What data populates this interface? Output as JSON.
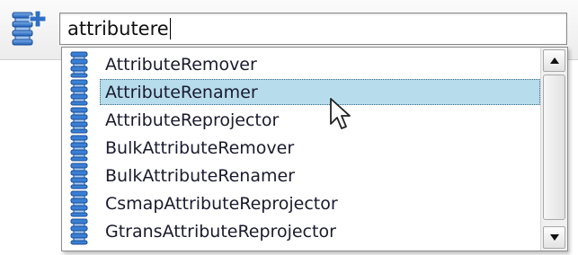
{
  "search": {
    "value": "attributere"
  },
  "suggestions": [
    {
      "label": "AttributeRemover",
      "selected": false
    },
    {
      "label": "AttributeRenamer",
      "selected": true
    },
    {
      "label": "AttributeReprojector",
      "selected": false
    },
    {
      "label": "BulkAttributeRemover",
      "selected": false
    },
    {
      "label": "BulkAttributeRenamer",
      "selected": false
    },
    {
      "label": "CsmapAttributeReprojector",
      "selected": false
    },
    {
      "label": "GtransAttributeReprojector",
      "selected": false
    }
  ],
  "icons": {
    "toolbar": "add-transformer-icon",
    "item": "transformer-icon",
    "scroll_up": "arrow-up-icon",
    "scroll_down": "arrow-down-icon",
    "pointer": "mouse-pointer-icon"
  },
  "colors": {
    "icon_blue": "#2f6fc6",
    "selection": "#b7dcec",
    "text": "#1a1a2e"
  }
}
